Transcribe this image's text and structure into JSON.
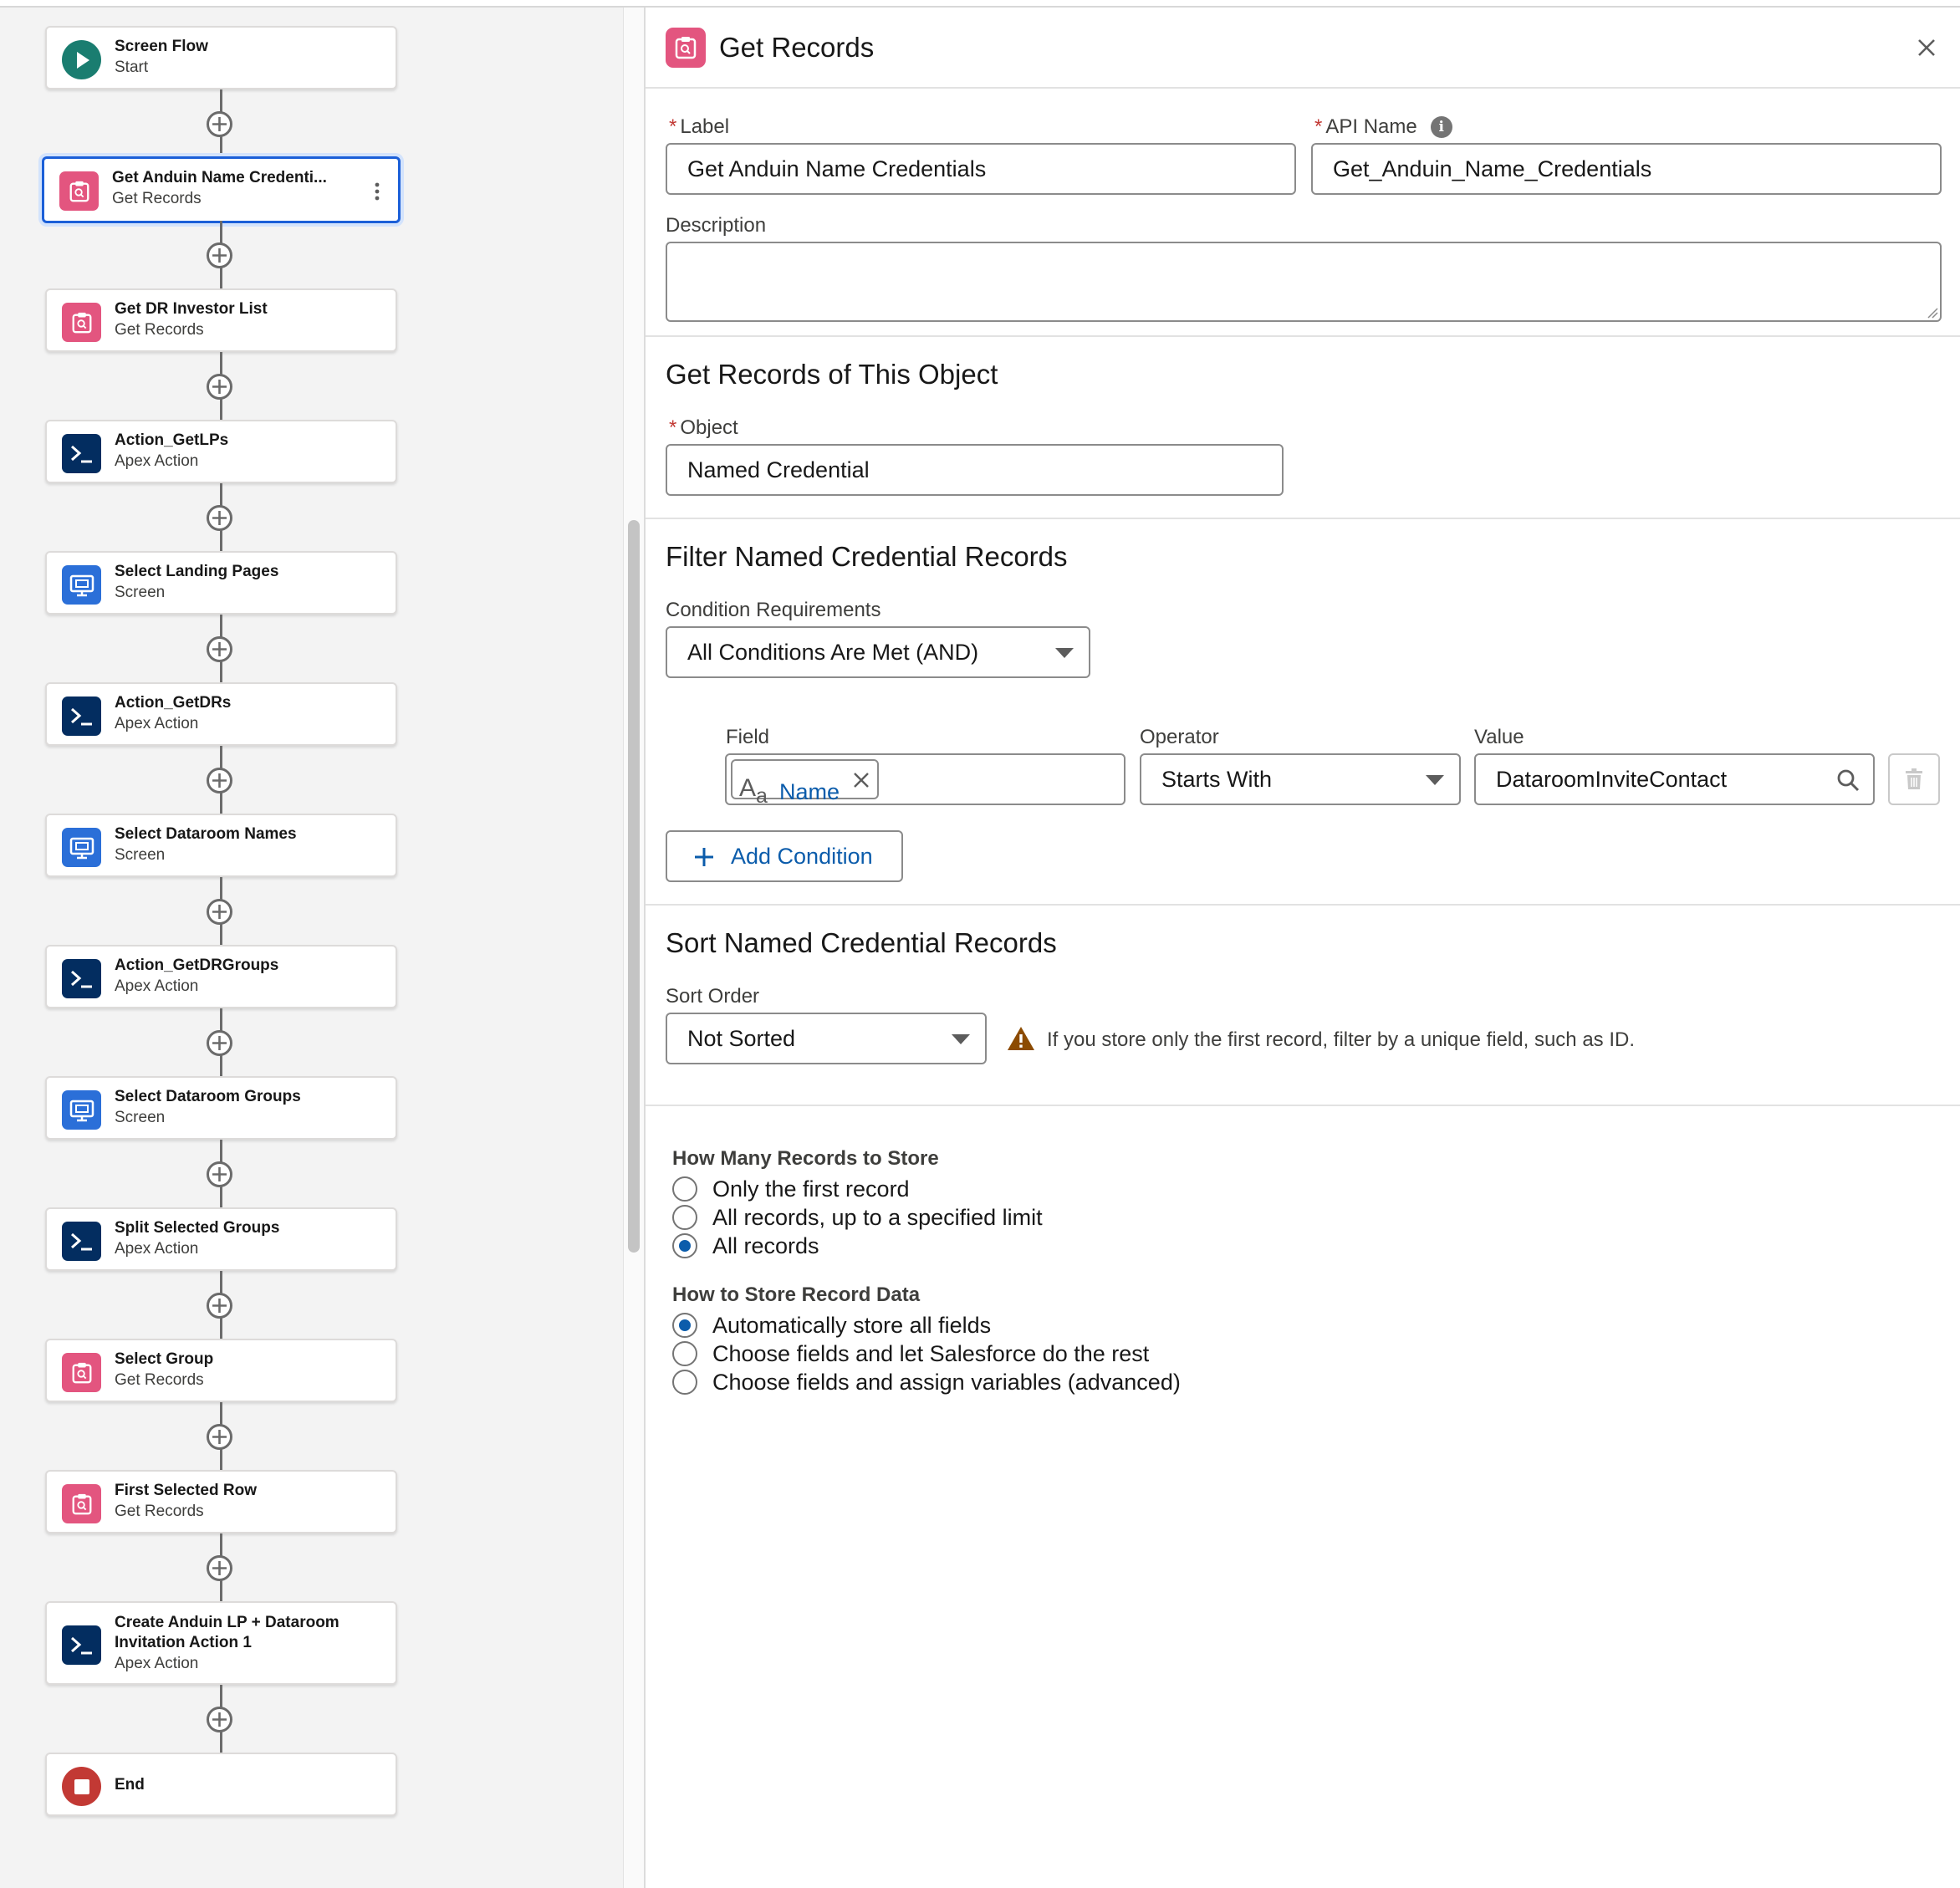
{
  "flow": {
    "nodes": [
      {
        "title": "Screen Flow",
        "subtitle": "Start",
        "kind": "start",
        "icon": "play-icon"
      },
      {
        "title": "Get Anduin Name Credenti...",
        "subtitle": "Get Records",
        "kind": "get-records",
        "icon": "get-records-icon",
        "selected": true
      },
      {
        "title": "Get DR Investor List",
        "subtitle": "Get Records",
        "kind": "get-records",
        "icon": "get-records-icon"
      },
      {
        "title": "Action_GetLPs",
        "subtitle": "Apex Action",
        "kind": "apex",
        "icon": "apex-icon"
      },
      {
        "title": "Select Landing Pages",
        "subtitle": "Screen",
        "kind": "screen",
        "icon": "screen-icon"
      },
      {
        "title": "Action_GetDRs",
        "subtitle": "Apex Action",
        "kind": "apex",
        "icon": "apex-icon"
      },
      {
        "title": "Select Dataroom Names",
        "subtitle": "Screen",
        "kind": "screen",
        "icon": "screen-icon"
      },
      {
        "title": "Action_GetDRGroups",
        "subtitle": "Apex Action",
        "kind": "apex",
        "icon": "apex-icon"
      },
      {
        "title": "Select Dataroom Groups",
        "subtitle": "Screen",
        "kind": "screen",
        "icon": "screen-icon"
      },
      {
        "title": "Split Selected Groups",
        "subtitle": "Apex Action",
        "kind": "apex",
        "icon": "apex-icon"
      },
      {
        "title": "Select Group",
        "subtitle": "Get Records",
        "kind": "get-records",
        "icon": "get-records-icon"
      },
      {
        "title": "First Selected Row",
        "subtitle": "Get Records",
        "kind": "get-records",
        "icon": "get-records-icon"
      },
      {
        "title": "Create Anduin LP + Dataroom",
        "title2": "Invitation Action 1",
        "subtitle": "Apex Action",
        "kind": "apex",
        "icon": "apex-icon"
      },
      {
        "title": "End",
        "subtitle": "",
        "kind": "end",
        "icon": "stop-icon"
      }
    ]
  },
  "panel": {
    "title": "Get Records",
    "label": {
      "label": "Label",
      "value": "Get Anduin Name Credentials"
    },
    "api_name": {
      "label": "API Name",
      "value": "Get_Anduin_Name_Credentials"
    },
    "description": {
      "label": "Description",
      "value": ""
    },
    "object_section": {
      "title": "Get Records of This Object",
      "object_label": "Object",
      "object_value": "Named Credential"
    },
    "filter_section": {
      "title": "Filter Named Credential Records",
      "condition_label": "Condition Requirements",
      "condition_value": "All Conditions Are Met (AND)",
      "field_label": "Field",
      "field_icon_text": "A",
      "field_icon_sub": "a",
      "field_value": "Name",
      "operator_label": "Operator",
      "operator_value": "Starts With",
      "value_label": "Value",
      "value_value": "DataroomInviteContact",
      "add_condition": "Add Condition"
    },
    "sort_section": {
      "title": "Sort Named Credential Records",
      "sort_label": "Sort Order",
      "sort_value": "Not Sorted",
      "warning": "If you store only the first record, filter by a unique field, such as ID."
    },
    "store_count": {
      "title": "How Many Records to Store",
      "options": [
        "Only the first record",
        "All records, up to a specified limit",
        "All records"
      ],
      "selected": 2
    },
    "store_how": {
      "title": "How to Store Record Data",
      "options": [
        "Automatically store all fields",
        "Choose fields and let Salesforce do the rest",
        "Choose fields and assign variables (advanced)"
      ],
      "selected": 0
    }
  },
  "colors": {
    "get_records": "#e3557f",
    "apex": "#032d60",
    "screen": "#2b6fd8",
    "start": "#1a7d70",
    "end": "#c23934",
    "link": "#0b5cab",
    "selected_border": "#1b5fd8"
  }
}
